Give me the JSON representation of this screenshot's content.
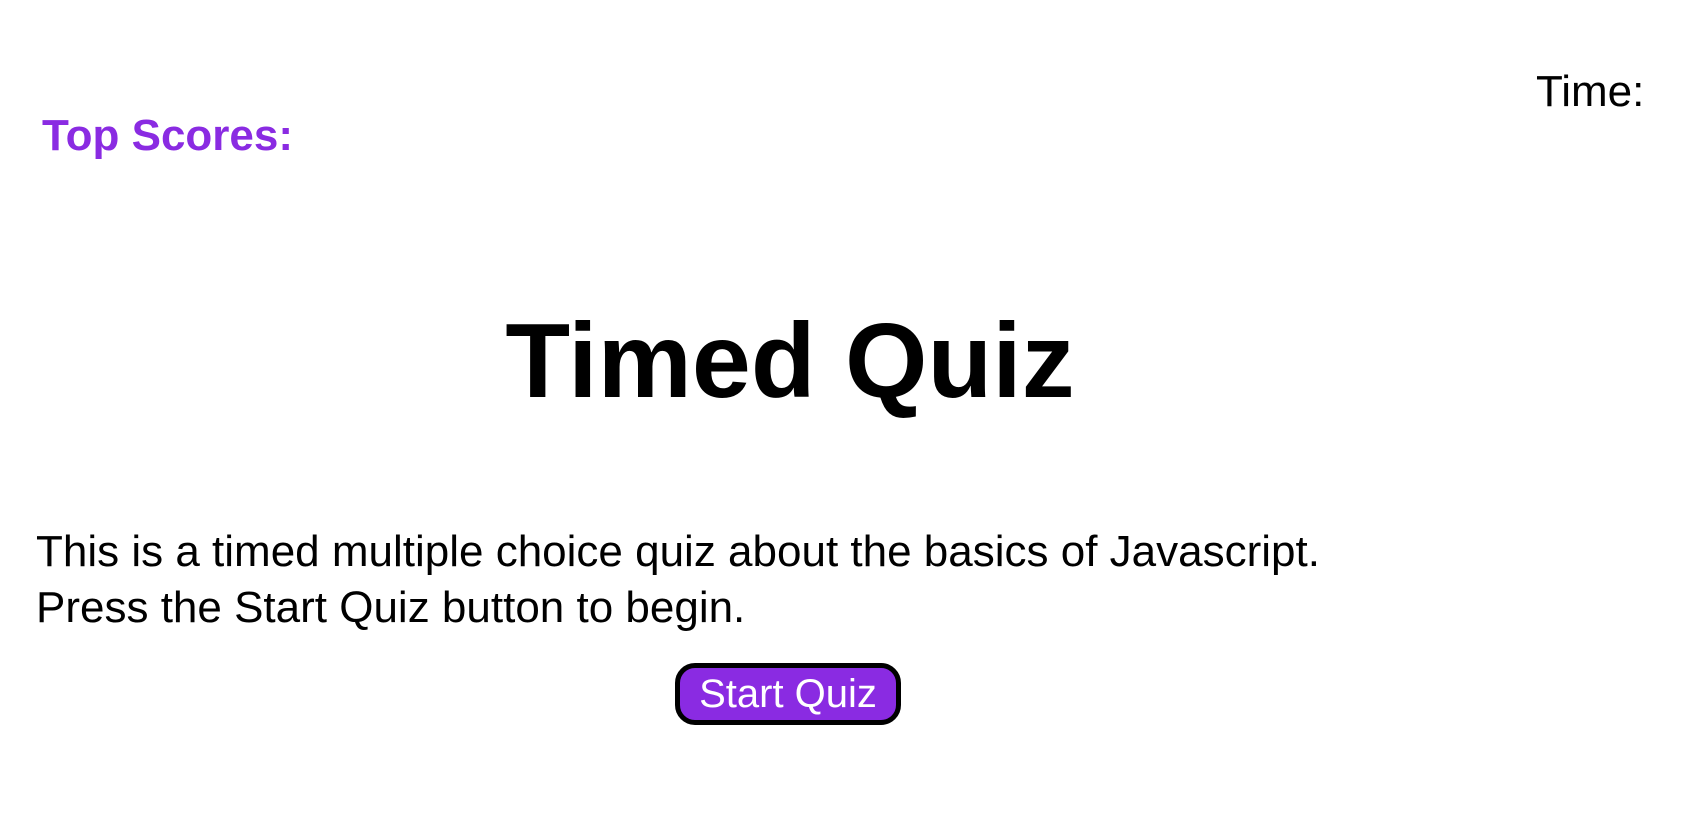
{
  "header": {
    "top_scores_label": "Top Scores:",
    "time_label": "Time:",
    "time_value": ""
  },
  "main": {
    "title": "Timed Quiz",
    "description_line1": "This is a timed multiple choice quiz about the basics of Javascript.",
    "description_line2": "Press the Start Quiz button to begin.",
    "start_button_label": "Start Quiz"
  },
  "colors": {
    "accent": "#8a2be2",
    "text": "#000000",
    "background": "#ffffff",
    "button_text": "#ffffff",
    "button_border": "#000000"
  }
}
